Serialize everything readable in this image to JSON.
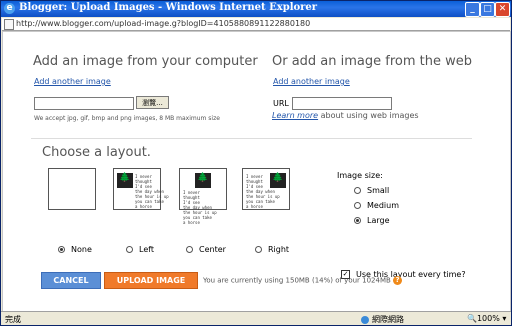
{
  "window": {
    "title": "Blogger: Upload Images - Windows Internet Explorer",
    "controls": {
      "minimize": "_",
      "maximize": "□",
      "close": "✕"
    }
  },
  "address": {
    "url": "http://www.blogger.com/upload-image.g?blogID=4105880891122880180"
  },
  "upload": {
    "left_heading": "Add an image from your computer",
    "left_add_link": "Add another image",
    "browse_label": "瀏覽...",
    "accept_text": "We accept jpg, gif, bmp and png images, 8 MB maximum size",
    "right_heading": "Or add an image from the web",
    "right_add_link": "Add another image",
    "url_label": "URL",
    "learn_more": "Learn more",
    "learn_suffix": " about using web images"
  },
  "layout": {
    "title": "Choose a layout.",
    "options": [
      {
        "label": "None",
        "selected": true
      },
      {
        "label": "Left",
        "selected": false
      },
      {
        "label": "Center",
        "selected": false
      },
      {
        "label": "Right",
        "selected": false
      }
    ],
    "sample_text": "I never\nthought\nI'd see\nthe day when\nthe hour is up\nyou can take\na horse"
  },
  "image_size": {
    "label": "Image size:",
    "options": [
      {
        "label": "Small",
        "selected": false
      },
      {
        "label": "Medium",
        "selected": false
      },
      {
        "label": "Large",
        "selected": true
      }
    ]
  },
  "remember": {
    "label": "Use this layout every time?",
    "checked": true
  },
  "actions": {
    "cancel": "CANCEL",
    "upload": "UPLOAD IMAGE",
    "usage": "You are currently using 150MB (14%) of your 1024MB",
    "help": "?"
  },
  "status": {
    "left": "完成",
    "zone": "網際網路",
    "zoom": "100%"
  },
  "colors": {
    "cancel": "#5b8fd6",
    "upload": "#f07a2a",
    "link": "#2255aa"
  }
}
